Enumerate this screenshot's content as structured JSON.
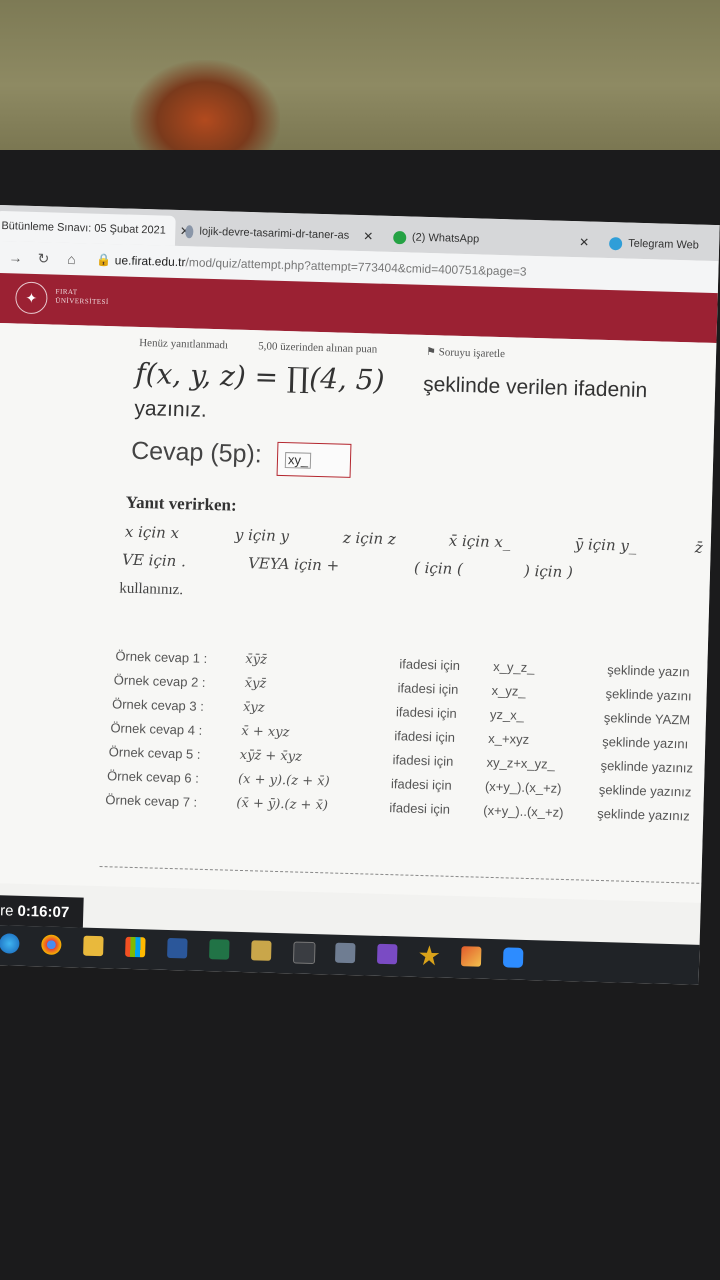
{
  "tabs": [
    {
      "label": "Bütünleme Sınavı: 05 Şubat 2021",
      "close": "✕"
    },
    {
      "label": "lojik-devre-tasarimi-dr-taner-as",
      "close": "✕"
    },
    {
      "label": "(2) WhatsApp",
      "close": "✕"
    },
    {
      "label": "Telegram Web"
    }
  ],
  "address": {
    "domain": "ue.firat.edu.tr",
    "path": "/mod/quiz/attempt.php?attempt=773404&cmid=400751&page=3"
  },
  "header": {
    "logo_line1": "FIRAT",
    "logo_line2": "ÜNİVERSİTESİ"
  },
  "question": {
    "status": "Henüz yanıtlanmadı",
    "points": "5,00 üzerinden alınan puan",
    "flag": "Soruyu işaretle",
    "formula": "f(x, y, z) = ∏(4, 5)",
    "text": "şeklinde verilen ifadenin",
    "text2": "yazınız.",
    "answer_label": "Cevap (5p):",
    "answer_value": "xy_"
  },
  "instructions": {
    "heading": "Yanıt verirken:",
    "r1": [
      "x için x",
      "y için y",
      "z için z",
      "x̄ için x_",
      "ȳ için y_",
      "z̄"
    ],
    "r2": [
      "VE için .",
      "VEYA için +",
      "( için (",
      ") için )"
    ],
    "r3": "kullanınız."
  },
  "examples": [
    {
      "label": "Örnek cevap 1 :",
      "expr": "x̄ȳz̄",
      "ifadesi": "ifadesi için",
      "ans": "x_y_z_",
      "tail": "şeklinde yazın"
    },
    {
      "label": "Örnek cevap 2 :",
      "expr": "x̄yz̄",
      "ifadesi": "ifadesi için",
      "ans": "x_yz_",
      "tail": "şeklinde yazını"
    },
    {
      "label": "Örnek cevap 3 :",
      "expr": "x̄yz",
      "ifadesi": "ifadesi için",
      "ans": "yz_x_",
      "tail": "şeklinde YAZM"
    },
    {
      "label": "Örnek cevap 4 :",
      "expr": "x̄ + xyz",
      "ifadesi": "ifadesi için",
      "ans": "x_+xyz",
      "tail": "şeklinde yazını"
    },
    {
      "label": "Örnek cevap 5 :",
      "expr": "xȳz̄ + x̄yz",
      "ifadesi": "ifadesi için",
      "ans": "xy_z+x_yz_",
      "tail": "şeklinde yazınız"
    },
    {
      "label": "Örnek cevap 6 :",
      "expr": "(x + y).(z + x̄)",
      "ifadesi": "ifadesi için",
      "ans": "(x+y_).(x_+z)",
      "tail": "şeklinde yazınız"
    },
    {
      "label": "Örnek cevap 7 :",
      "expr": "(x̄ + ȳ).(z + x̄)",
      "ifadesi": "ifadesi için",
      "ans": "(x+y_)..(x_+z)",
      "tail": "şeklinde yazınız"
    }
  ],
  "timer": {
    "label": "süre",
    "value": "0:16:07"
  },
  "taskbar_icons": [
    "edge-icon",
    "chrome-icon",
    "file-explorer-icon",
    "store-icon",
    "word-icon",
    "excel-icon",
    "notes-icon",
    "terminal-icon",
    "box-icon",
    "visual-studio-icon",
    "star-icon",
    "paint-icon",
    "zoom-icon"
  ],
  "colors": {
    "header": "#9b2133",
    "answer_border": "#b3262e"
  }
}
